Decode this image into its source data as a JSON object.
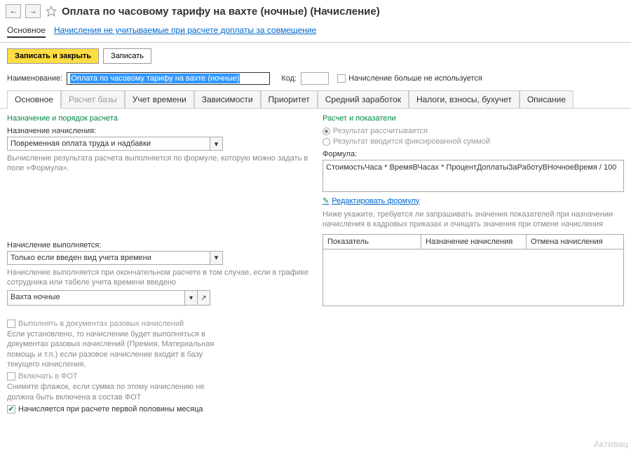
{
  "header": {
    "title": "Оплата по часовому тарифу на вахте (ночные) (Начисление)"
  },
  "nav": {
    "main": "Основное",
    "link": "Начисления не учитываемые при расчете доплаты за совмещение"
  },
  "toolbar": {
    "save_close": "Записать и закрыть",
    "save": "Записать"
  },
  "form": {
    "name_label": "Наименование:",
    "name_value": "Оплата по часовому тарифу на вахте (ночные)",
    "code_label": "Код:",
    "code_value": "",
    "not_used_label": "Начисление больше не используется"
  },
  "tabs": [
    "Основное",
    "Расчет базы",
    "Учет времени",
    "Зависимости",
    "Приоритет",
    "Средний заработок",
    "Налоги, взносы, бухучет",
    "Описание"
  ],
  "left": {
    "section": "Назначение и порядок расчета",
    "purpose_label": "Назначение начисления:",
    "purpose_value": "Повременная оплата труда и надбавки",
    "purpose_help": "Вычисление результата расчета выполняется по формуле, которую можно задать в поле «Формула».",
    "performed_label": "Начисление выполняется:",
    "performed_value": "Только если введен вид учета времени",
    "performed_help": "Начисление выполняется при окончательном расчете в том случае, если в графике сотрудника или табеле учета времени введено",
    "shift_value": "Вахта ночные"
  },
  "right": {
    "section": "Расчет и показатели",
    "radio1": "Результат рассчитывается",
    "radio2": "Результат вводится фиксированной суммой",
    "formula_label": "Формула:",
    "formula_value": "СтоимостьЧаса * ВремяВЧасах * ПроцентДоплатыЗаРаботуВНочноеВремя / 100",
    "edit_formula": "Редактировать формулу",
    "table_help": "Ниже укажите, требуется ли запрашивать значения показателей при назначении начисления в кадровых приказах и очищать значения при отмене начисления",
    "th1": "Показатель",
    "th2": "Назначение начисления",
    "th3": "Отмена начисления"
  },
  "bottom": {
    "cb1": "Выполнять в документах разовых начислений",
    "cb1_help": "Если установлено, то начисление будет выполняться в документах разовых начислений (Премия, Материальная помощь и т.п.) если разовое начисление входит в базу текущего начисления.",
    "cb2": "Включать в ФОТ",
    "cb2_help": "Снимите флажок, если сумма по этому начислению не должна быть включена в состав ФОТ",
    "cb3": "Начисляется при расчете первой половины месяца"
  },
  "watermark": "Активац"
}
